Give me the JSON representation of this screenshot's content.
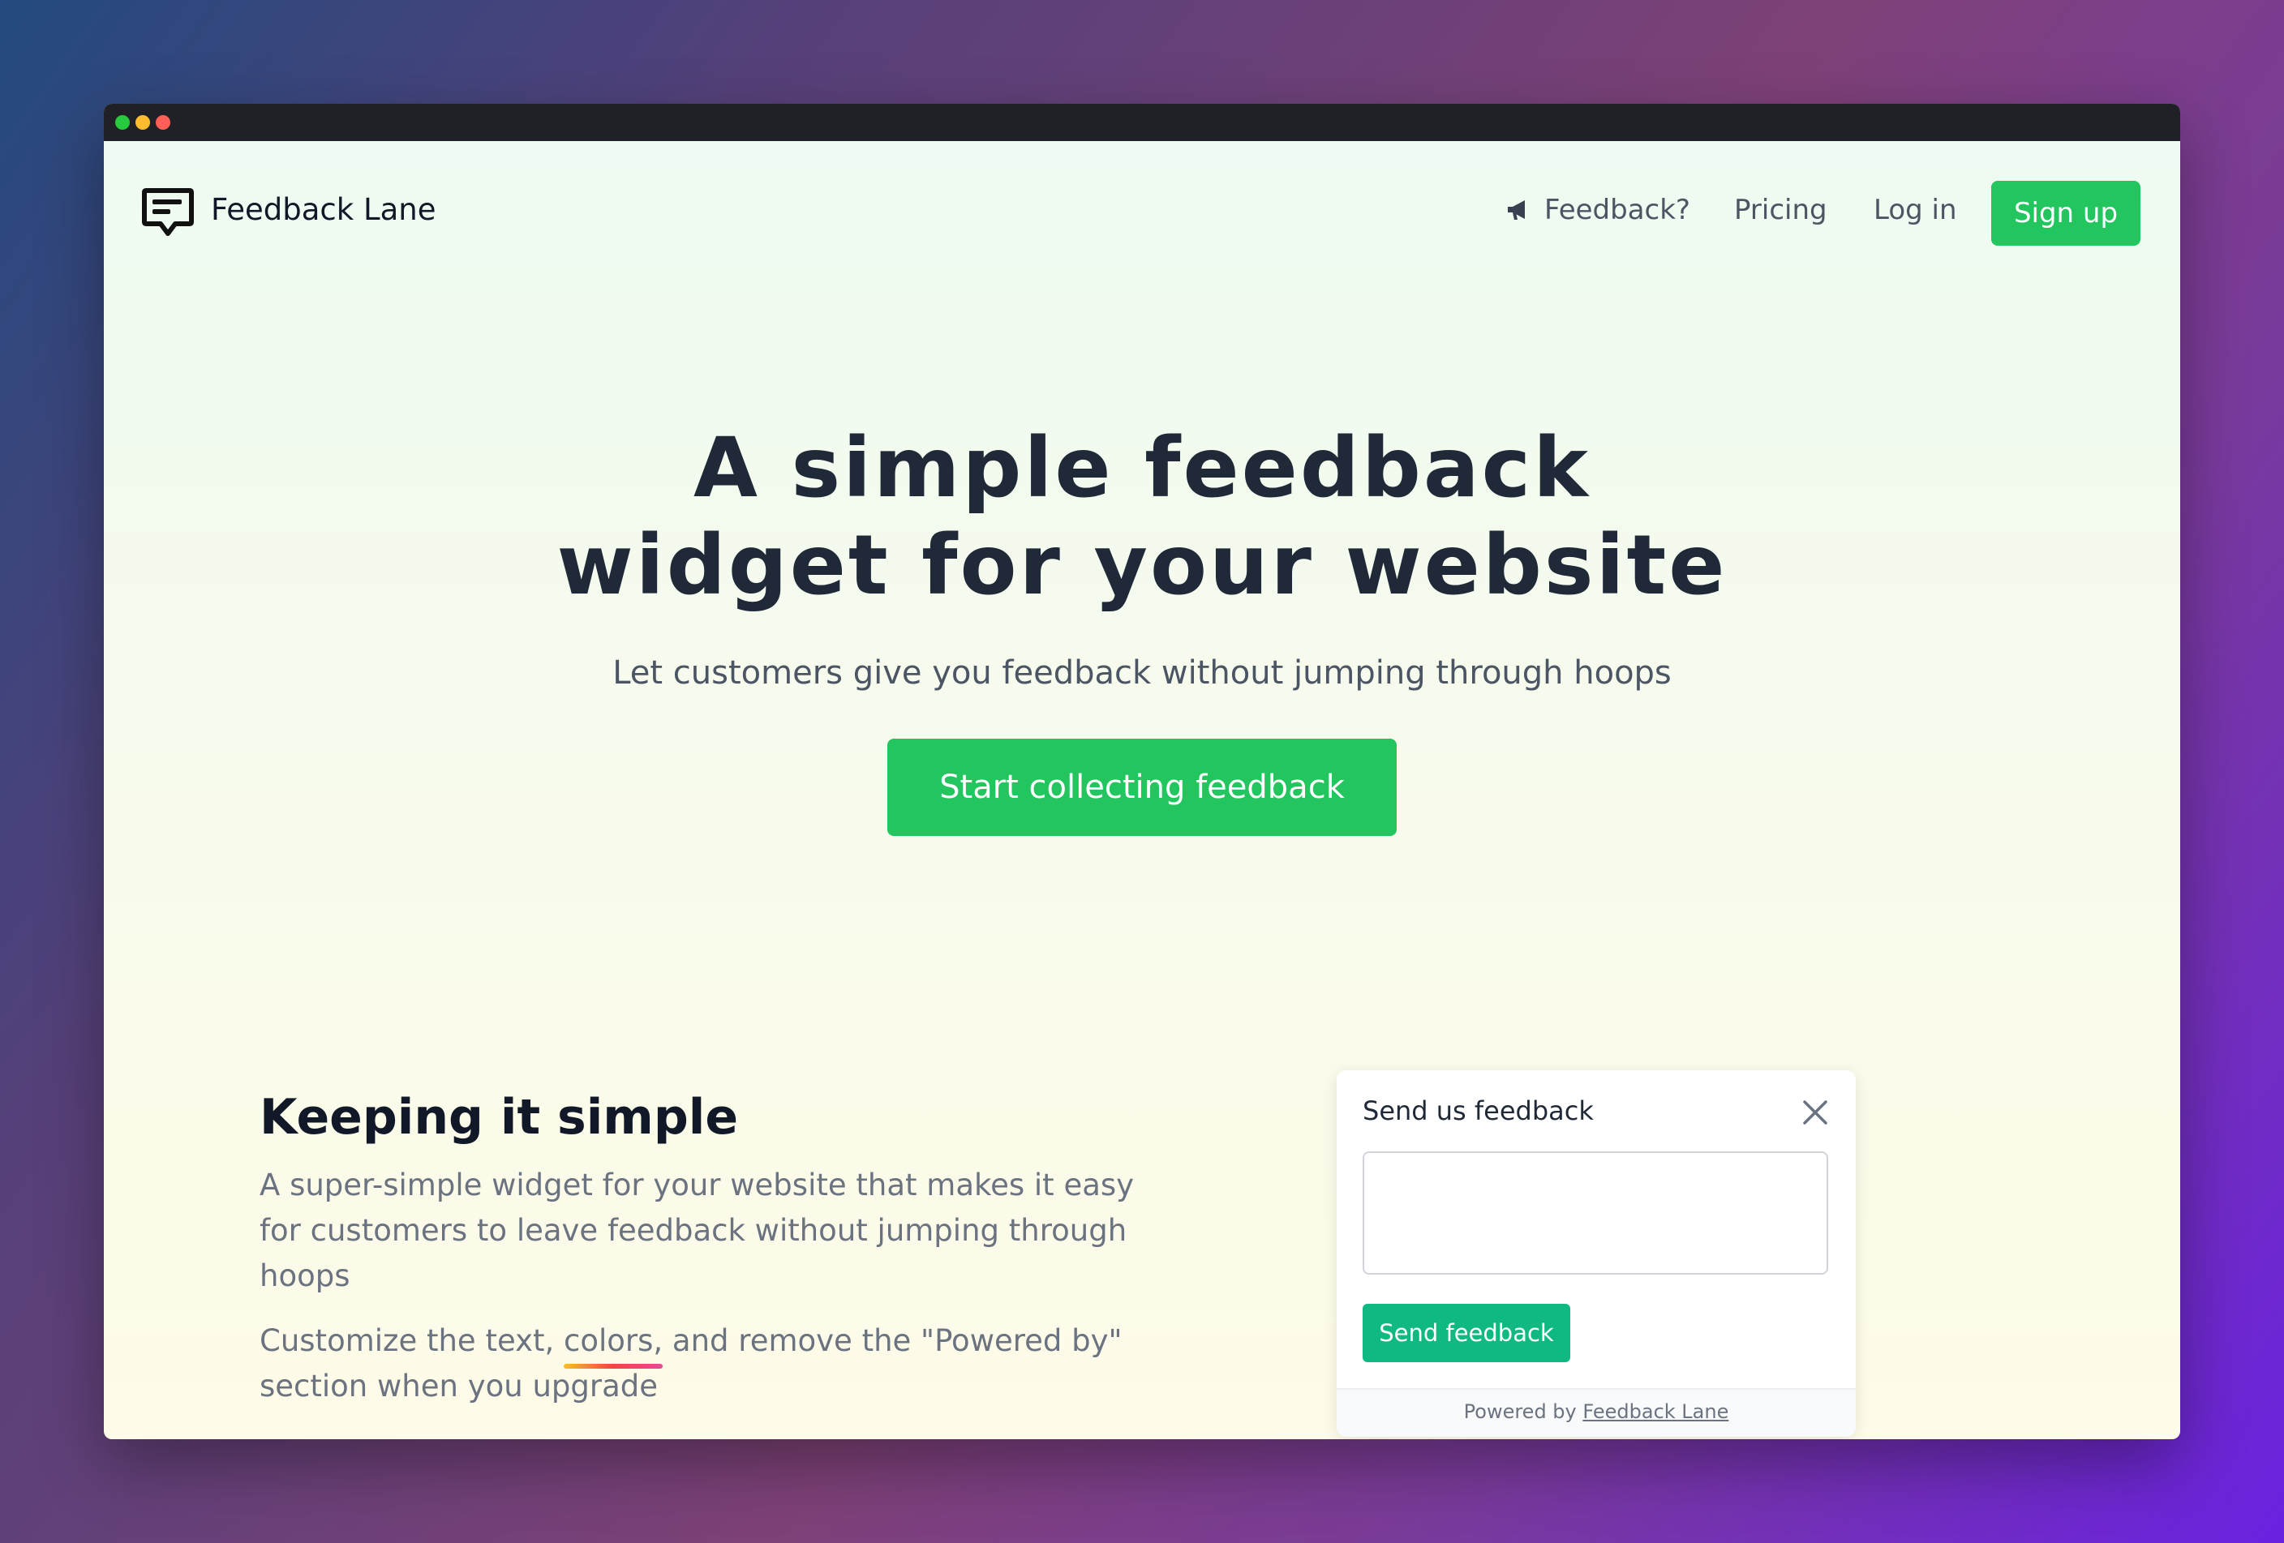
{
  "header": {
    "brand": "Feedback Lane",
    "nav": {
      "feedback": "Feedback?",
      "pricing": "Pricing",
      "login": "Log in",
      "signup": "Sign up"
    }
  },
  "hero": {
    "title_line1": "A simple feedback",
    "title_line2": "widget for your website",
    "subtitle": "Let customers give you feedback without jumping through hoops",
    "cta": "Start collecting feedback"
  },
  "features": {
    "title": "Keeping it simple",
    "paragraph1": "A super-simple widget for your website that makes it easy for customers to leave feedback without jumping through hoops",
    "paragraph2_before": "Customize the text, ",
    "paragraph2_highlight": "colors,",
    "paragraph2_after": " and remove the \"Powered by\" section when you upgrade"
  },
  "widget": {
    "title": "Send us feedback",
    "textarea_value": "",
    "send_button": "Send feedback",
    "footer_prefix": "Powered by ",
    "footer_link": "Feedback Lane"
  },
  "colors": {
    "accent_green": "#22c55e",
    "widget_button": "#10b981",
    "heading": "#1f2937",
    "titlebar": "#202126",
    "underline_gradient": [
      "#fbbf24",
      "#ef4444",
      "#ec4899"
    ]
  },
  "icons": {
    "logo": "chat-bubble-icon",
    "nav_feedback": "megaphone-icon",
    "widget_close": "close-icon"
  }
}
